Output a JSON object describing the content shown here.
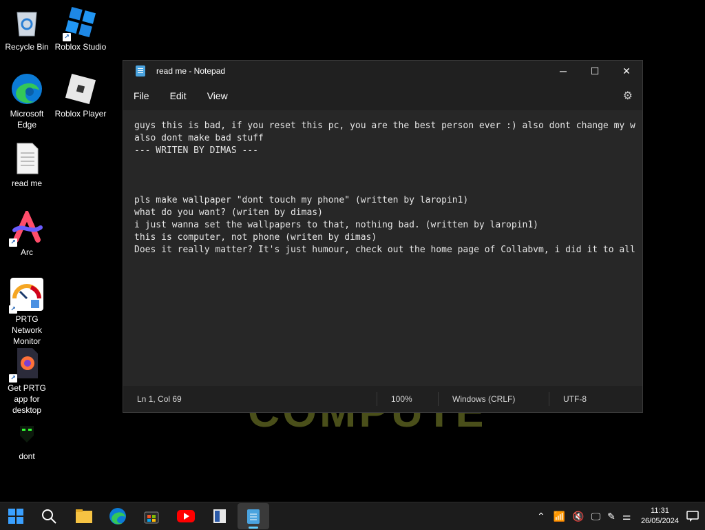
{
  "wallpaper": {
    "text": "COMPUTER"
  },
  "desktop": {
    "icons": [
      {
        "label": "Recycle Bin"
      },
      {
        "label": "Roblox Studio"
      },
      {
        "label": "Microsoft Edge"
      },
      {
        "label": "Roblox Player"
      },
      {
        "label": "read me"
      },
      {
        "label": "Arc"
      },
      {
        "label": "PRTG Network Monitor"
      },
      {
        "label": "Get PRTG app for desktop"
      },
      {
        "label": "dont"
      }
    ]
  },
  "notepad": {
    "title": "read me - Notepad",
    "menu": [
      "File",
      "Edit",
      "View"
    ],
    "content": "guys this is bad, if you reset this pc, you are the best person ever :) also dont change my w\nalso dont make bad stuff\n--- WRITEN BY DIMAS ---\n\n\n\npls make wallpaper \"dont touch my phone\" (written by laropin1)\nwhat do you want? (writen by dimas)\ni just wanna set the wallpapers to that, nothing bad. (written by laropin1)\nthis is computer, not phone (writen by dimas)\nDoes it really matter? It's just humour, check out the home page of Collabvm, i did it to all",
    "status": {
      "position": "Ln 1, Col 69",
      "zoom": "100%",
      "line_ending": "Windows (CRLF)",
      "encoding": "UTF-8"
    }
  },
  "taskbar": {
    "apps": [
      "start-icon",
      "search-icon",
      "file-explorer-icon",
      "edge-icon",
      "store-icon",
      "youtube-icon",
      "reader-icon",
      "notepad-icon"
    ],
    "clock": {
      "time": "11:31",
      "date": "26/05/2024"
    }
  }
}
